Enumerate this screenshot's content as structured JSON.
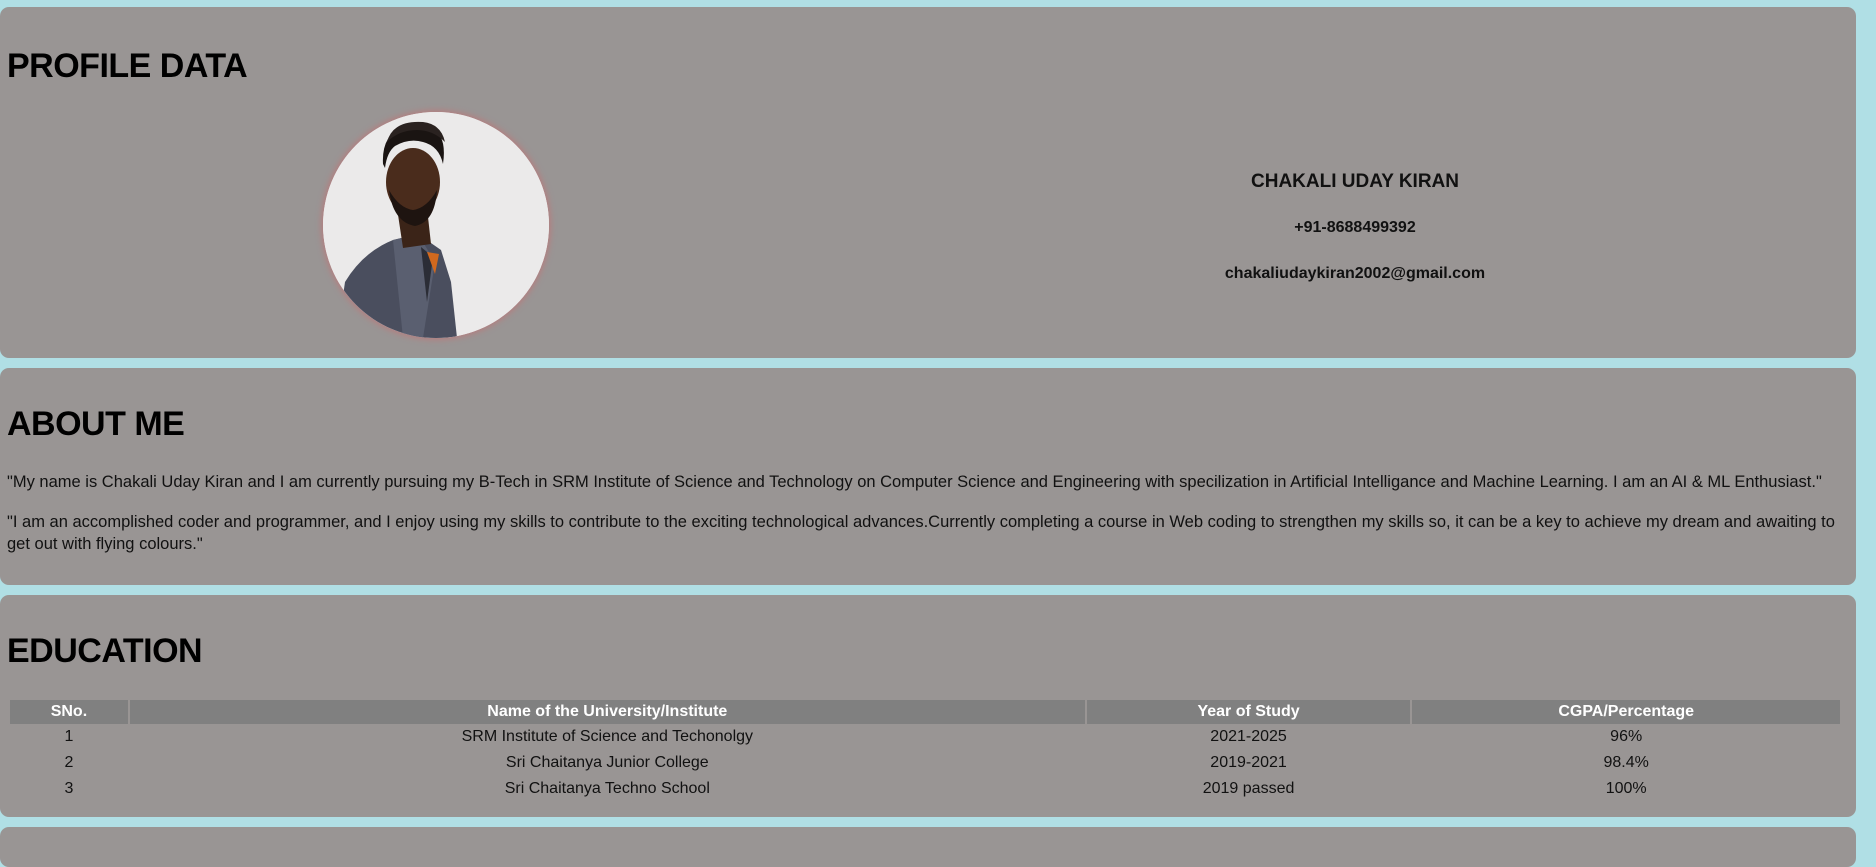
{
  "profile": {
    "title": "PROFILE DATA",
    "name": "CHAKALI UDAY KIRAN",
    "phone": "+91-8688499392",
    "email": "chakaliudaykiran2002@gmail.com"
  },
  "about": {
    "title": "ABOUT ME",
    "paragraphs": [
      "\"My name is Chakali Uday Kiran and I am currently pursuing my B-Tech in SRM Institute of Science and Technology on Computer Science and Engineering with specilization in Artificial Intelligance and Machine Learning. I am an AI & ML Enthusiast.\"",
      "\"I am an accomplished coder and programmer, and I enjoy using my skills to contribute to the exciting technological advances.Currently completing a course in Web coding to strengthen my skills so, it can be a key to achieve my dream and awaiting to get out with flying colours.\""
    ]
  },
  "education": {
    "title": "EDUCATION",
    "columns": [
      "SNo.",
      "Name of the University/Institute",
      "Year of Study",
      "CGPA/Percentage"
    ],
    "rows": [
      [
        "1",
        "SRM Institute of Science and Techonolgy",
        "2021-2025",
        "96%"
      ],
      [
        "2",
        "Sri Chaitanya Junior College",
        "2019-2021",
        "98.4%"
      ],
      [
        "3",
        "Sri Chaitanya Techno School",
        "2019 passed",
        "100%"
      ]
    ]
  },
  "colors": {
    "page_background": "#b0dfe5",
    "card_background": "#999594",
    "table_header": "#808080"
  }
}
